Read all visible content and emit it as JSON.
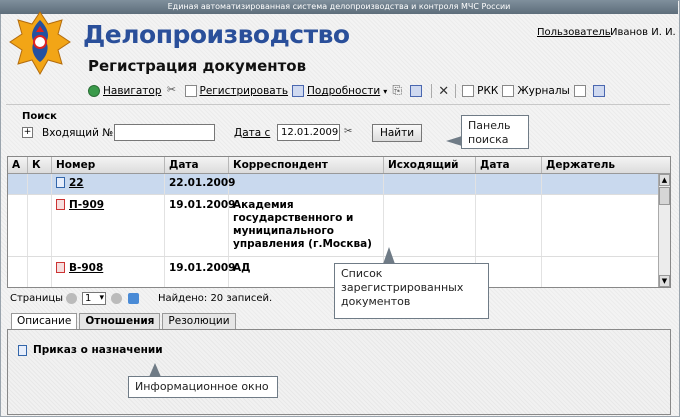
{
  "topbar": {
    "text": "Единая автоматизированная система делопроизводства и контроля МЧС России"
  },
  "header": {
    "app_title": "Делопроизводство",
    "page_title": "Регистрация документов",
    "user_link": "Пользователь",
    "user_name": "Иванов И. И."
  },
  "toolbar": {
    "navigator": "Навигатор",
    "register": "Регистрировать",
    "details": "Подробности",
    "rkk": "РКК",
    "journals": "Журналы"
  },
  "search": {
    "legend": "Поиск",
    "expand": "+",
    "incoming_label": "Входящий №",
    "incoming_value": "",
    "date_label": "Дата с",
    "date_value": "12.01.2009",
    "find_button": "Найти"
  },
  "grid": {
    "headers": [
      "А",
      "К",
      "Номер",
      "Дата",
      "Корреспондент",
      "Исходящий",
      "Дата",
      "Держатель"
    ],
    "rows": [
      {
        "number": "22",
        "date": "22.01.2009",
        "correspondent": "",
        "selected": true,
        "icon": "document-icon"
      },
      {
        "number": "П-909",
        "date": "19.01.2009",
        "correspondent": "Академия государственного и муниципального управления (г.Москва)",
        "selected": false,
        "icon": "incoming-document-icon"
      },
      {
        "number": "В-908",
        "date": "19.01.2009",
        "correspondent": "АД",
        "selected": false,
        "icon": "pdf-document-icon"
      }
    ]
  },
  "pager": {
    "label": "Страницы",
    "page": "1",
    "found": "Найдено: 20 записей."
  },
  "tabs": [
    "Описание",
    "Отношения",
    "Резолюции"
  ],
  "info": {
    "document": "Приказ о назначении"
  },
  "callouts": {
    "search_panel": "Панель поиска",
    "list": "Список зарегистрированных документов",
    "info_window": "Информационное окно"
  },
  "colors": {
    "title_blue": "#2a4f9a",
    "selected_row": "#c9d9ee"
  }
}
